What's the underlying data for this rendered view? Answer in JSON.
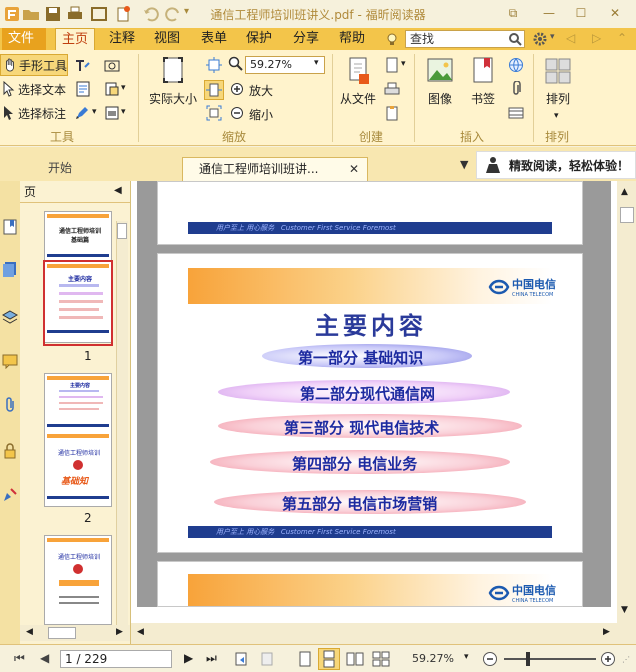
{
  "window": {
    "title": "通信工程师培训班讲义.pdf - 福昕阅读器",
    "controls": [
      "restore",
      "minimize",
      "maximize",
      "close"
    ]
  },
  "menubar": {
    "items": [
      "文件",
      "主页",
      "注释",
      "视图",
      "表单",
      "保护",
      "分享",
      "帮助"
    ],
    "active": "主页",
    "search_value": "查找"
  },
  "ribbon": {
    "tools": {
      "hand": "手形工具",
      "select_text": "选择文本",
      "select_annot": "选择标注",
      "label": "工具"
    },
    "zoom": {
      "actual_size": "实际大小",
      "value": "59.27%",
      "zoom_in": "放大",
      "zoom_out": "缩小",
      "label": "缩放"
    },
    "create": {
      "from_file": "从文件",
      "label": "创建"
    },
    "insert": {
      "image": "图像",
      "bookmark": "书签",
      "label": "插入"
    },
    "arrange": {
      "arrange": "排列",
      "label": "排列"
    }
  },
  "tabs": {
    "start": "开始",
    "doc": "通信工程师培训班讲...",
    "promo": "精致阅读，轻松体验！"
  },
  "thumbpanel": {
    "header": "页",
    "pages": [
      "1",
      "2"
    ],
    "thumb1_title": "通信工程师培训",
    "thumb1_sub": "基础篇",
    "thumb2_title": "主要内容",
    "thumb3_title": "通信工程师培训",
    "thumb3_sub": "基础知",
    "thumb4_title": "通信工程师培训"
  },
  "document": {
    "footer_slogan": "用户至上  用心服务",
    "footer_english": "Customer First Service Foremost",
    "logo_cn": "中国电信",
    "logo_en": "CHINA TELECOM",
    "slide_title": "主要内容",
    "items": [
      "第一部分  基础知识",
      "第二部分现代通信网",
      "第三部分  现代电信技术",
      "第四部分  电信业务",
      "第五部分  电信市场营销"
    ]
  },
  "statusbar": {
    "page_value": "1 / 229",
    "zoom": "59.27%"
  },
  "colors": {
    "menu_bg": "#f3c54a",
    "ribbon_bg": "#fff3cc",
    "accent": "#c04010",
    "slide_blue": "#1c2aa0",
    "footer_blue": "#1f3d8f"
  }
}
